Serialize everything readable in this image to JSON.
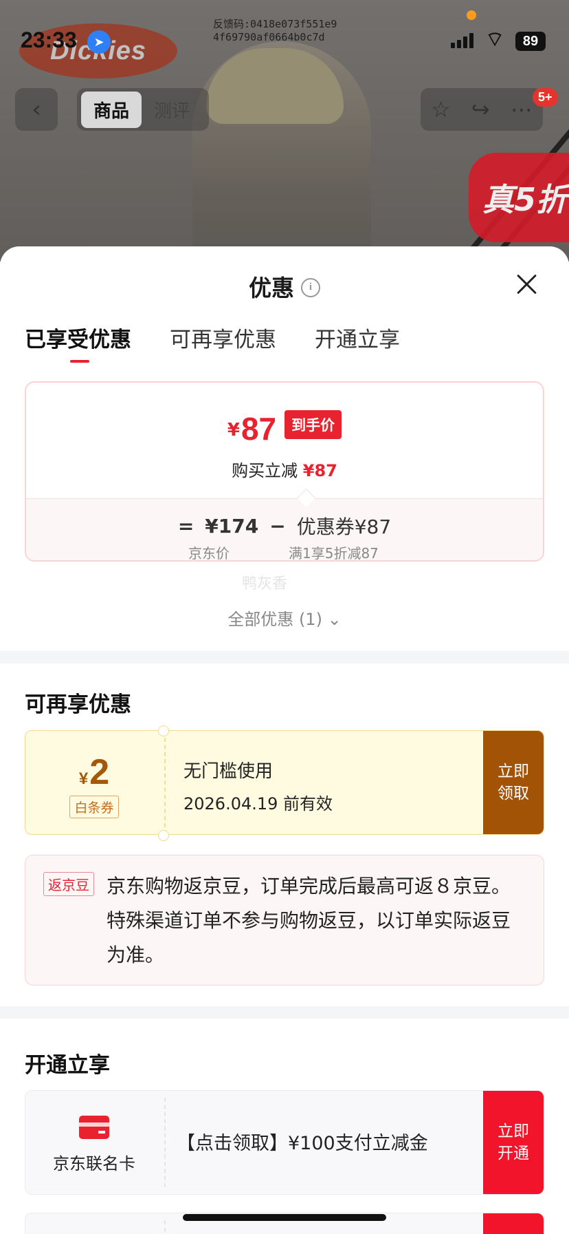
{
  "status_bar": {
    "time": "23:33",
    "battery": "89",
    "feedback_code_line1": "反馈码:0418e073f551e9",
    "feedback_code_line2": "4f69790af0664b0c7d"
  },
  "background": {
    "brand_logo": "Dickies",
    "promo_badge": "真5折",
    "notification_count": "5+"
  },
  "header": {
    "back_icon": "chevron-left-icon",
    "segment_product": "商品",
    "segment_review": "测评"
  },
  "sheet": {
    "title": "优惠",
    "tabs": [
      {
        "label": "已享受优惠"
      },
      {
        "label": "可再享优惠"
      },
      {
        "label": "开通立享"
      }
    ],
    "price": {
      "currency": "¥",
      "final_price": "87",
      "final_tag": "到手价",
      "save_label": "购买立减",
      "save_amount": "¥87",
      "equals": "=",
      "jd_price": "¥174",
      "minus": "−",
      "coupon_label": "优惠券¥87",
      "jd_price_caption": "京东价",
      "coupon_caption": "满1享5折减87"
    },
    "watermark": "鸭灰香",
    "all_offers": "全部优惠 (1)"
  },
  "more_offers": {
    "title": "可再享优惠",
    "coupon": {
      "currency": "¥",
      "amount": "2",
      "tag": "白条券",
      "desc": "无门槛使用",
      "valid": "2026.04.19 前有效",
      "claim_line1": "立即",
      "claim_line2": "领取"
    },
    "jd_bean": {
      "tag": "返京豆",
      "text": "京东购物返京豆，订单完成后最高可返８京豆。特殊渠道订单不参与购物返豆，以订单实际返豆为准。"
    }
  },
  "open_offers": {
    "title": "开通立享",
    "card": {
      "name": "京东联名卡",
      "desc": "【点击领取】¥100支付立减金",
      "claim_line1": "立即",
      "claim_line2": "开通"
    }
  },
  "colors": {
    "accent_red": "#e8232f",
    "coupon_brown": "#a35306",
    "coupon_bg": "#fffbe0"
  }
}
